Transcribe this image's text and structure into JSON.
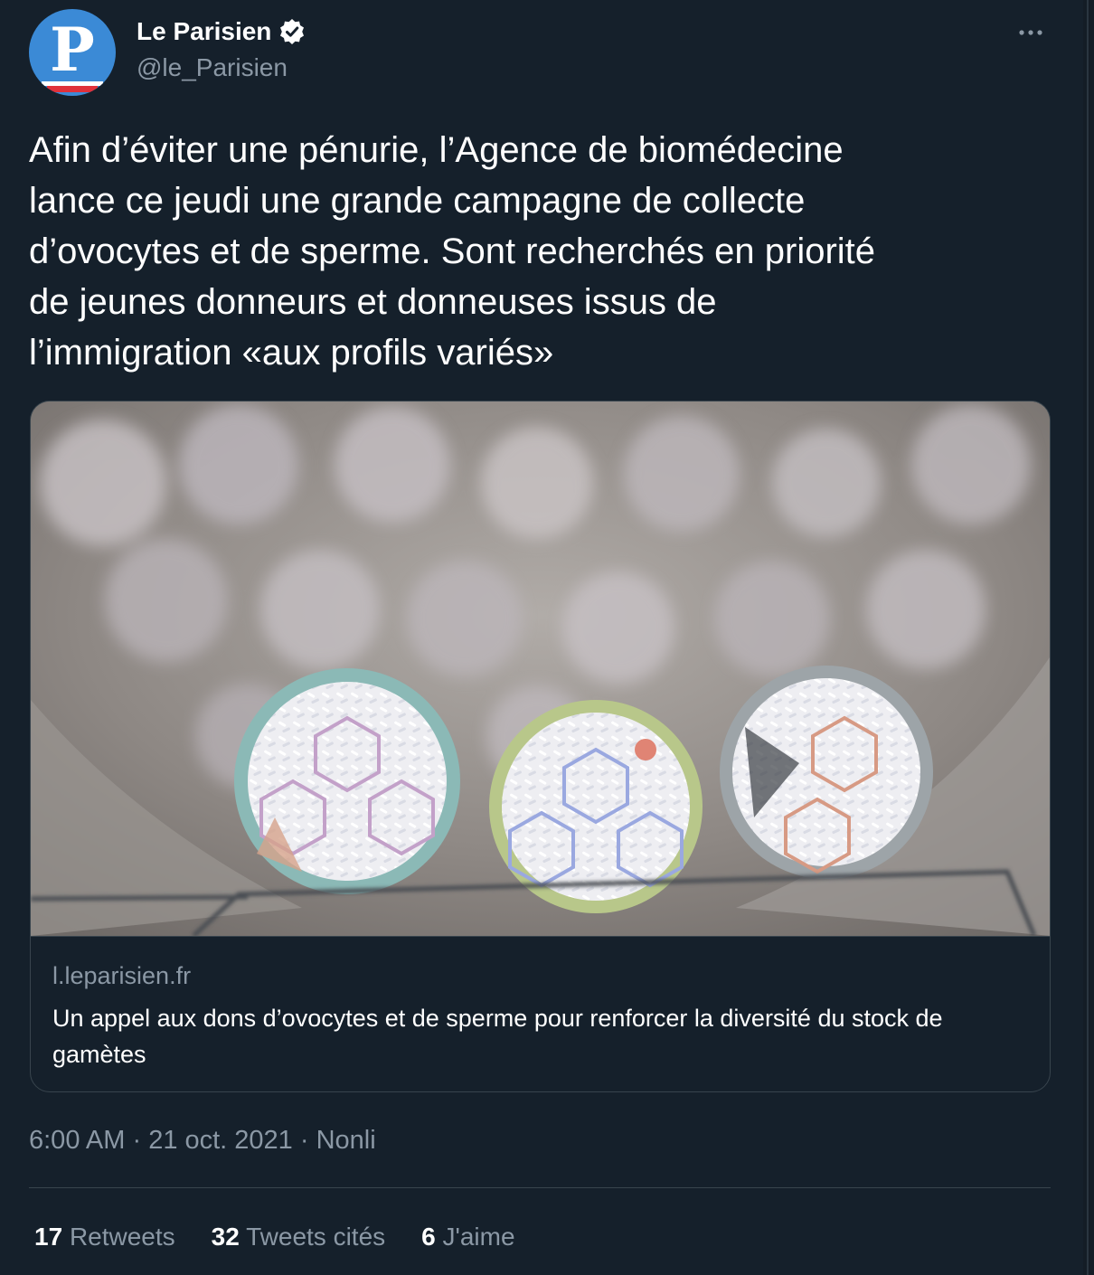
{
  "author": {
    "name": "Le Parisien",
    "handle": "@le_Parisien",
    "avatar_letter": "P",
    "verified": true
  },
  "tweet": {
    "text": "Afin d’éviter une pénurie, l’Agence de biomédecine\nlance ce jeudi une grande campagne de collecte\nd’ovocytes et de sperme. Sont recherchés en priorité\nde jeunes donneurs et donneuses issus de\nl’immigration «aux profils variés»"
  },
  "card": {
    "domain": "l.leparisien.fr",
    "title": "Un appel aux dons d’ovocytes et de sperme pour renforcer la diversité du stock de gamètes"
  },
  "meta": {
    "time": "6:00 AM",
    "separator": " · ",
    "date": "21 oct. 2021",
    "source": "Nonli"
  },
  "stats": {
    "retweets_count": "17",
    "retweets_label": "Retweets",
    "quotes_count": "32",
    "quotes_label": "Tweets cités",
    "likes_count": "6",
    "likes_label": "J'aime"
  },
  "colors": {
    "background": "#15202b",
    "secondary_text": "#8b98a5",
    "border": "#38444d",
    "avatar_blue": "#3b8ad6",
    "avatar_red": "#e0313b"
  },
  "icons": {
    "verified": "verified-badge-icon",
    "more": "more-options-icon"
  }
}
